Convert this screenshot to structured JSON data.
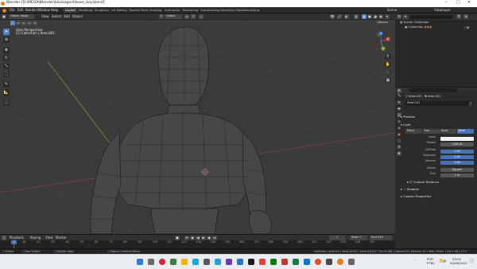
{
  "window": {
    "title": "Blender [D:\\MEGA\\Blender\\blockagent\\base_boy.blend]",
    "minimize": "–",
    "maximize": "□",
    "close": "✕"
  },
  "menu": {
    "items": [
      "File",
      "Edit",
      "Render",
      "Window",
      "Help"
    ],
    "workspaces": [
      "Layout",
      "Modeling",
      "Sculpting",
      "UV Editing",
      "Texture Paint",
      "Shading",
      "Animation",
      "Rendering",
      "Compositing",
      "Geometry Nodes",
      "Scripting"
    ],
    "active_workspace": "Layout",
    "scene_label": "Scene",
    "view_layer_label": "ViewLayer"
  },
  "viewport": {
    "mode": "Object Mode",
    "header_menu": [
      "View",
      "Select",
      "Add",
      "Object"
    ],
    "orientation": "Global",
    "options_label": "Options",
    "info_line1": "User Perspective",
    "info_line2": "(1) Collection | Area.001",
    "gizmo": {
      "x": "X",
      "y": "Y",
      "z": "Z"
    }
  },
  "outliner": {
    "root": "Scene Collection",
    "child": "Collection"
  },
  "properties": {
    "object_name": "Area.001",
    "data_name": "Area.001",
    "data_block": "Area.001",
    "preview_label": "Preview",
    "light_label": "Light",
    "light_types": [
      "Point",
      "Sun",
      "Spot",
      "Area"
    ],
    "active_light_type": "Area",
    "rows": [
      {
        "label": "Color",
        "value": "",
        "style": "white"
      },
      {
        "label": "Power",
        "value": "1000 W",
        "style": "grey"
      },
      {
        "label": "Diffuse",
        "value": "1.00",
        "style": "blue"
      },
      {
        "label": "Specular",
        "value": "1.00",
        "style": "blue"
      },
      {
        "label": "Volume",
        "value": "1.00",
        "style": "blue"
      },
      {
        "label": "Shape",
        "value": "Square",
        "style": "grey"
      },
      {
        "label": "Size",
        "value": "1 m",
        "style": "grey"
      }
    ],
    "custom_distance": "Custom Distance",
    "shadow": "Shadow",
    "custom_properties": "Custom Properties"
  },
  "timeline": {
    "menu": [
      "Playback",
      "Keying",
      "View",
      "Marker"
    ],
    "current_frame": "1",
    "start_label": "Start",
    "start_value": "1",
    "end_label": "End",
    "end_value": "250",
    "ticks": [
      "10",
      "20",
      "30",
      "40",
      "50",
      "60",
      "70",
      "80",
      "90",
      "100",
      "110",
      "120",
      "130",
      "140",
      "150",
      "160",
      "170",
      "180",
      "190",
      "200",
      "210",
      "220",
      "230",
      "240",
      "250"
    ]
  },
  "status": {
    "select": "Select",
    "box_select": "Box Select",
    "rotate": "Rotate View",
    "context_menu": "Object Context Menu",
    "stats": "Collection | Area.001 | Verts:16,507 | Faces:16,507 | Tris:30,384 | Objects:0/3 | Memory: 61.1 MiB | VRAM: 1.3/4.0 GiB | 3.2.0"
  },
  "taskbar": {
    "lang": "POR",
    "lang2": "PTB2",
    "time": "03:03",
    "date": "04/06/2022"
  },
  "colors": {
    "accent": "#4772b3",
    "viewport_bg": "#3b3b3b",
    "panel_bg": "#2b2b2b"
  }
}
